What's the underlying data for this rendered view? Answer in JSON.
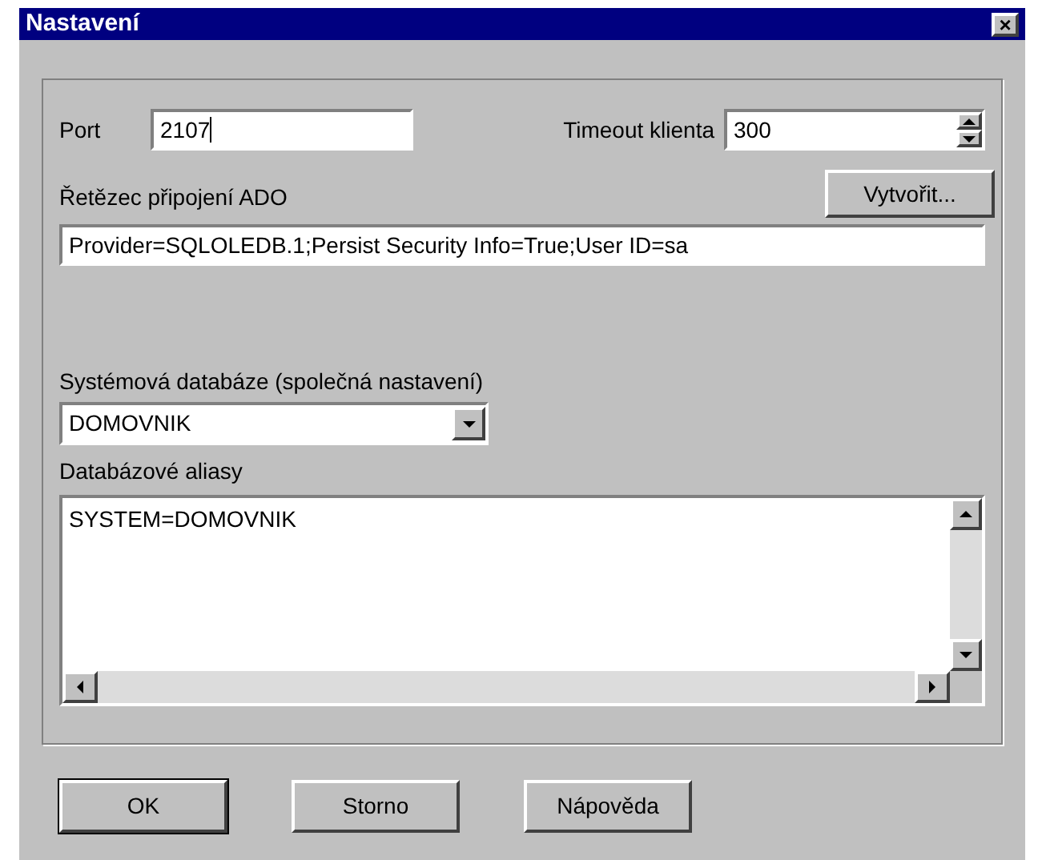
{
  "window": {
    "title": "Nastavení",
    "close": "×"
  },
  "port": {
    "label": "Port",
    "value": "2107"
  },
  "timeout": {
    "label": "Timeout klienta",
    "value": "300"
  },
  "connection": {
    "label": "Řetězec připojení ADO",
    "button": "Vytvořit...",
    "value": "Provider=SQLOLEDB.1;Persist Security Info=True;User ID=sa"
  },
  "system_db": {
    "label": "Systémová databáze (společná nastavení)",
    "value": "DOMOVNIK"
  },
  "aliases": {
    "label": "Databázové aliasy",
    "value": "SYSTEM=DOMOVNIK"
  },
  "buttons": [
    {
      "label": "OK",
      "default": true
    },
    {
      "label": "Storno",
      "default": false
    },
    {
      "label": "Nápověda",
      "default": false
    }
  ]
}
